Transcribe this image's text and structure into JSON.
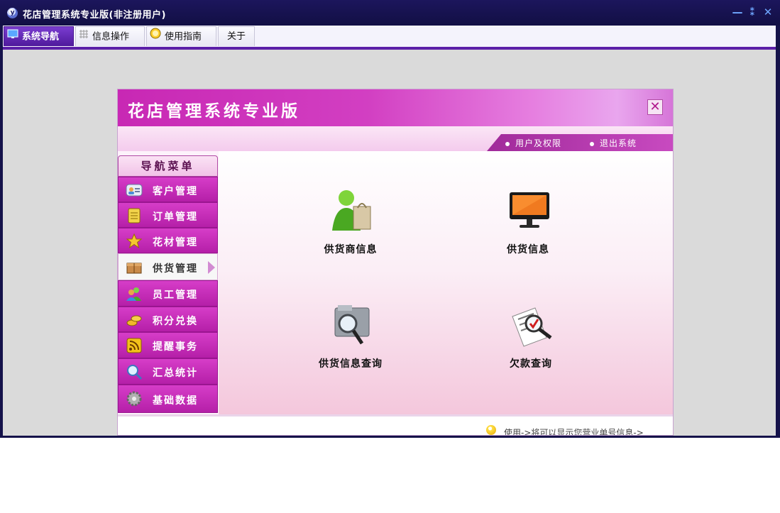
{
  "window": {
    "title": "花店管理系统专业版(非注册用户)",
    "icon": "app-logo-icon",
    "controls": {
      "minimize": "—",
      "restore": "⁑",
      "close": "✕"
    }
  },
  "menu_tabs": [
    {
      "label": "系统导航",
      "icon": "monitor-icon",
      "active": true
    },
    {
      "label": "信息操作",
      "icon": "grid-icon",
      "active": false
    },
    {
      "label": "使用指南",
      "icon": "clock-icon",
      "active": false
    },
    {
      "label": "关于",
      "icon": "",
      "active": false
    }
  ],
  "panel": {
    "title": "花店管理系统专业版",
    "links": [
      {
        "label": "用户及权限"
      },
      {
        "label": "退出系统"
      }
    ]
  },
  "nav": {
    "header": "导航菜单",
    "items": [
      {
        "label": "客户管理",
        "icon": "contacts-icon",
        "active": false
      },
      {
        "label": "订单管理",
        "icon": "notepad-icon",
        "active": false
      },
      {
        "label": "花材管理",
        "icon": "star-icon",
        "active": false
      },
      {
        "label": "供货管理",
        "icon": "box-icon",
        "active": true
      },
      {
        "label": "员工管理",
        "icon": "users-icon",
        "active": false
      },
      {
        "label": "积分兑换",
        "icon": "coins-icon",
        "active": false
      },
      {
        "label": "提醒事务",
        "icon": "rss-icon",
        "active": false
      },
      {
        "label": "汇总统计",
        "icon": "magnifier-icon",
        "active": false
      },
      {
        "label": "基础数据",
        "icon": "gear-icon",
        "active": false
      }
    ]
  },
  "tiles": [
    {
      "label": "供货商信息",
      "icon": "supplier-person-bag-icon"
    },
    {
      "label": "供货信息",
      "icon": "monitor-icon"
    },
    {
      "label": "供货信息查询",
      "icon": "folder-search-icon"
    },
    {
      "label": "欠款查询",
      "icon": "document-search-icon"
    }
  ],
  "status": {
    "text": "使用->将可以显示您营业单号信息->"
  },
  "colors": {
    "title_bar": "#15124a",
    "menu_accent": "#5b1fa8",
    "banner": "#c828b4",
    "nav_item": "#c92dbb",
    "workspace": "#dadada"
  }
}
